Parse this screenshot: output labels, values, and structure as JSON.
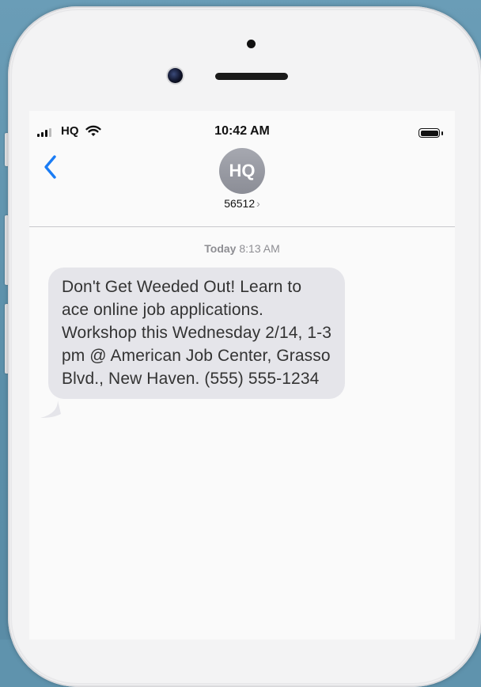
{
  "status_bar": {
    "carrier": "HQ",
    "time": "10:42 AM"
  },
  "conversation": {
    "avatar_initials": "HQ",
    "sender_number": "56512",
    "chevron": "›",
    "timestamp_day": "Today",
    "timestamp_time": "8:13 AM"
  },
  "messages": [
    {
      "direction": "incoming",
      "text": "Don't Get Weeded Out! Learn to ace online job applications. Workshop this Wednesday 2/14, 1-3 pm @ American Job Center, Grasso Blvd., New Haven. (555) 555-1234"
    }
  ],
  "icons": {
    "signal": "signal-bars-icon",
    "wifi": "wifi-icon",
    "battery": "battery-icon",
    "back": "chevron-left-icon"
  },
  "colors": {
    "accent": "#1a7cf5",
    "bubble_incoming": "#e5e5ea",
    "background": "#5f93ad"
  }
}
